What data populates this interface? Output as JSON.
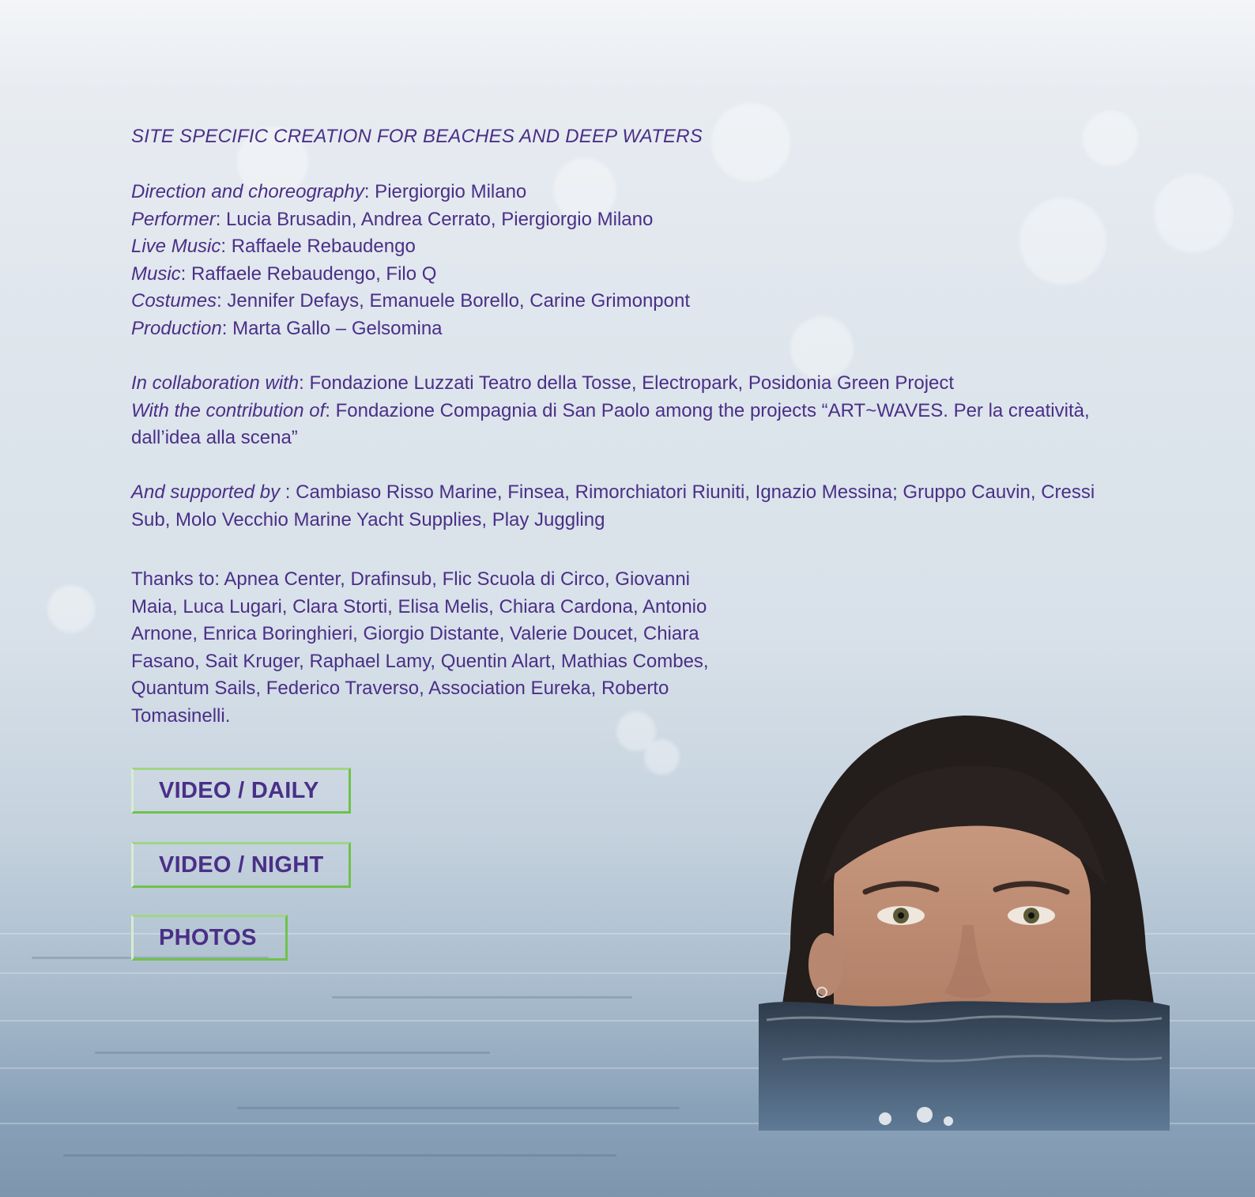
{
  "subtitle": "SITE SPECIFIC CREATION FOR BEACHES AND DEEP WATERS",
  "credits": [
    {
      "role": "Direction and choreography",
      "value": ": Piergiorgio Milano"
    },
    {
      "role": "Performer",
      "value": ": Lucia Brusadin, Andrea Cerrato, Piergiorgio Milano"
    },
    {
      "role": "Live Music",
      "value": ": Raffaele Rebaudengo"
    },
    {
      "role": "Music",
      "value": ": Raffaele Rebaudengo, Filo Q"
    },
    {
      "role": "Costumes",
      "value": ": Jennifer Defays, Emanuele Borello, Carine Grimonpont"
    },
    {
      "role": "Production",
      "value": ": Marta Gallo – Gelsomina"
    }
  ],
  "collaboration": {
    "role": "In collaboration with",
    "value": ": Fondazione Luzzati Teatro della Tosse, Electropark, Posidonia Green Project"
  },
  "contribution": {
    "role": "With the contribution of",
    "value": ": Fondazione Compagnia di San Paolo among the projects “ART~WAVES. Per la creatività, dall’idea alla scena”"
  },
  "supported": {
    "role": "And supported by",
    "value": " : Cambiaso Risso Marine, Finsea, Rimorchiatori Riuniti, Ignazio Messina; Gruppo Cauvin, Cressi Sub, Molo Vecchio Marine Yacht Supplies, Play Juggling"
  },
  "thanks": "Thanks to: Apnea Center, Drafinsub, Flic Scuola di Circo, Giovanni Maia, Luca Lugari, Clara Storti, Elisa Melis, Chiara Cardona, Antonio Arnone, Enrica Boringhieri, Giorgio Distante, Valerie Doucet, Chiara Fasano, Sait Kruger, Raphael Lamy, Quentin Alart, Mathias Combes, Quantum Sails, Federico Traverso, Association Eureka, Roberto Tomasinelli.",
  "buttons": {
    "video_daily": "VIDEO / DAILY",
    "video_night": "VIDEO / NIGHT",
    "photos": "PHOTOS"
  },
  "colors": {
    "text": "#4a2f87",
    "button_border": "#6fc24a"
  }
}
